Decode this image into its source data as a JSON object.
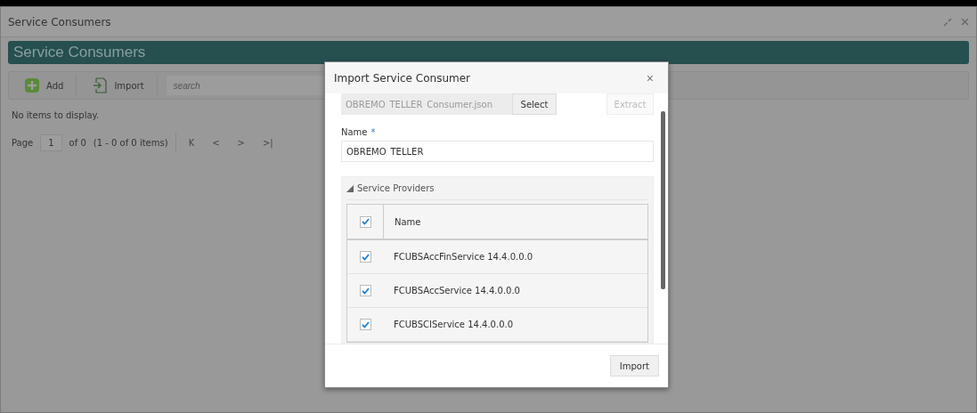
{
  "window": {
    "title": "Service Consumers"
  },
  "panel": {
    "title": "Service Consumers"
  },
  "toolbar": {
    "buttons": [
      {
        "kind": "add",
        "label": "Add"
      },
      {
        "kind": "import",
        "label": "Import"
      }
    ],
    "search": {
      "placeholder": "search"
    }
  },
  "empty_message": "No items to display.",
  "pager": {
    "page_label": "Page",
    "page": "1",
    "of": "of 0",
    "summary": "(1 - 0 of 0 items)",
    "nav": [
      "K",
      "<",
      ">",
      ">|"
    ]
  },
  "dialog": {
    "title": "Import Service Consumer",
    "close": "×",
    "file": {
      "value": "OBREMO_TELLER_Consumer.json"
    },
    "select_button": "Select",
    "extract_button": {
      "label": "Extract",
      "disabled": true
    },
    "name_label": "Name",
    "required_mark": "*",
    "name_value": "OBREMO_TELLER",
    "section": {
      "title": "Service Providers",
      "expanded": true,
      "header": {
        "label": "Name",
        "checked": true
      },
      "rows": [
        {
          "name": "FCUBSAccFinService 14.4.0.0.0",
          "checked": true
        },
        {
          "name": "FCUBSAccService 14.4.0.0.0",
          "checked": true
        },
        {
          "name": "FCUBSCIService 14.4.0.0.0",
          "checked": true
        }
      ]
    },
    "import_button": "Import"
  }
}
